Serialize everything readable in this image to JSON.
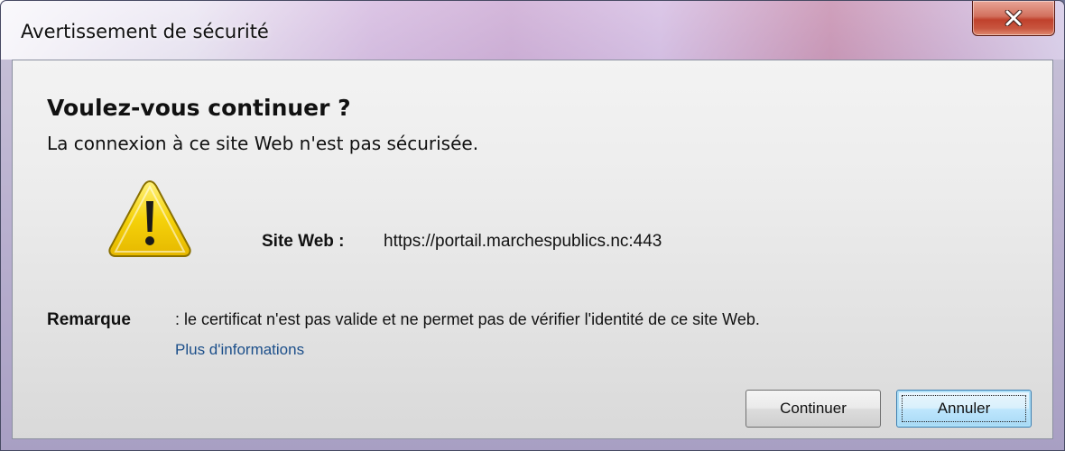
{
  "window": {
    "title": "Avertissement de sécurité",
    "close_icon": "close-icon"
  },
  "dialog": {
    "heading": "Voulez-vous continuer ?",
    "subheading": "La connexion à ce site Web n'est pas sécurisée.",
    "warning_icon": "warning-triangle-icon",
    "site_label": "Site Web :",
    "site_url": "https://portail.marchespublics.nc:443",
    "remark_label": "Remarque",
    "remark_text": ": le certificat n'est pas valide et ne permet pas de vérifier l'identité de ce site Web.",
    "more_info_link": "Plus d'informations"
  },
  "buttons": {
    "continue_label": "Continuer",
    "cancel_label": "Annuler"
  },
  "colors": {
    "link": "#1c4f8a",
    "close_button": "#c0412c",
    "warning_yellow": "#f5d20a",
    "focused_button_border": "#3c7fb1"
  }
}
